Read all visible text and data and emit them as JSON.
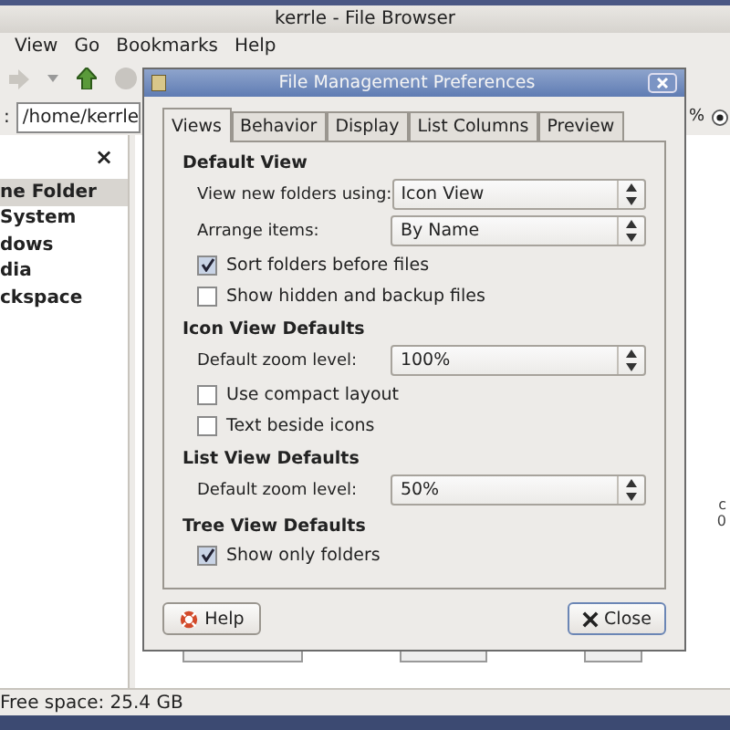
{
  "window": {
    "title": "kerrle - File Browser"
  },
  "menu": [
    "View",
    "Go",
    "Bookmarks",
    "Help"
  ],
  "location": {
    "label": ":",
    "value": "/home/kerrle"
  },
  "zoom_fragment": "%",
  "sidebar": {
    "close": "×",
    "items": [
      {
        "label": "ne Folder",
        "selected": true
      },
      {
        "label": "System",
        "selected": false
      },
      {
        "label": "dows",
        "selected": false
      },
      {
        "label": "dia",
        "selected": false
      },
      {
        "label": "ckspace",
        "selected": false
      }
    ]
  },
  "content_fragments": [
    "c",
    "0"
  ],
  "status_bar": "Free space: 25.4 GB",
  "dialog": {
    "title": "File Management Preferences",
    "tabs": [
      {
        "label": "Views",
        "selected": true
      },
      {
        "label": "Behavior",
        "selected": false
      },
      {
        "label": "Display",
        "selected": false
      },
      {
        "label": "List Columns",
        "selected": false
      },
      {
        "label": "Preview",
        "selected": false
      }
    ],
    "sections": [
      {
        "heading": "Default View",
        "rows": [
          {
            "kind": "select",
            "label": "View new folders using:",
            "value": "Icon View"
          },
          {
            "kind": "select",
            "label": "Arrange items:",
            "value": "By Name"
          },
          {
            "kind": "checkbox",
            "label": "Sort folders before files",
            "checked": true
          },
          {
            "kind": "checkbox",
            "label": "Show hidden and backup files",
            "checked": false
          }
        ]
      },
      {
        "heading": "Icon View Defaults",
        "rows": [
          {
            "kind": "select",
            "label": "Default zoom level:",
            "value": "100%"
          },
          {
            "kind": "checkbox",
            "label": "Use compact layout",
            "checked": false
          },
          {
            "kind": "checkbox",
            "label": "Text beside icons",
            "checked": false
          }
        ]
      },
      {
        "heading": "List View Defaults",
        "rows": [
          {
            "kind": "select",
            "label": "Default zoom level:",
            "value": "50%"
          }
        ]
      },
      {
        "heading": "Tree View Defaults",
        "rows": [
          {
            "kind": "checkbox",
            "label": "Show only folders",
            "checked": true
          }
        ]
      }
    ],
    "buttons": [
      {
        "label": "Help",
        "kind": "help"
      },
      {
        "label": "Close",
        "kind": "close"
      }
    ]
  }
}
